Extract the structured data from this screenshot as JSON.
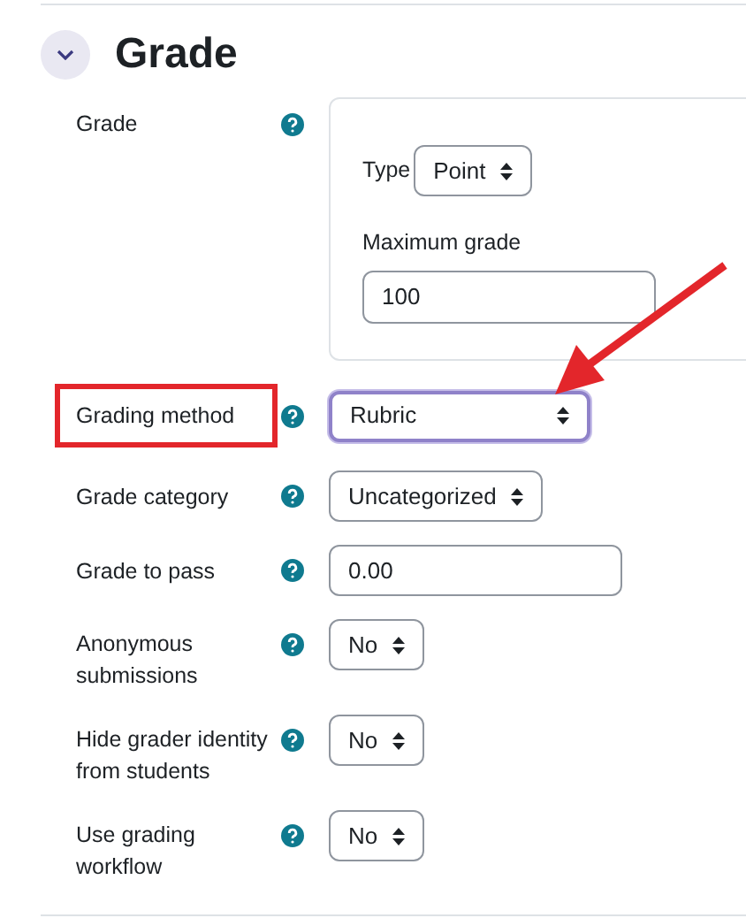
{
  "section": {
    "title": "Grade",
    "expanded": true
  },
  "fields": [
    {
      "kind": "group",
      "label": "Grade",
      "type_label": "Type",
      "type_value": "Point",
      "max_label": "Maximum grade",
      "max_value": "100",
      "highlighted": false
    },
    {
      "kind": "select",
      "label": "Grading method",
      "value": "Rubric",
      "focused": true,
      "highlighted": true,
      "wide": true
    },
    {
      "kind": "select",
      "label": "Grade category",
      "value": "Uncategorized",
      "focused": false,
      "highlighted": false,
      "wide": false
    },
    {
      "kind": "text",
      "label": "Grade to pass",
      "value": "0.00",
      "highlighted": false
    },
    {
      "kind": "select",
      "label": "Anonymous submissions",
      "value": "No",
      "focused": false,
      "highlighted": false,
      "wide": false
    },
    {
      "kind": "select",
      "label": "Hide grader identity from students",
      "value": "No",
      "focused": false,
      "highlighted": false,
      "wide": false
    },
    {
      "kind": "select",
      "label": "Use grading workflow",
      "value": "No",
      "focused": false,
      "highlighted": false,
      "wide": false
    }
  ],
  "annotation": {
    "arrow": true
  }
}
